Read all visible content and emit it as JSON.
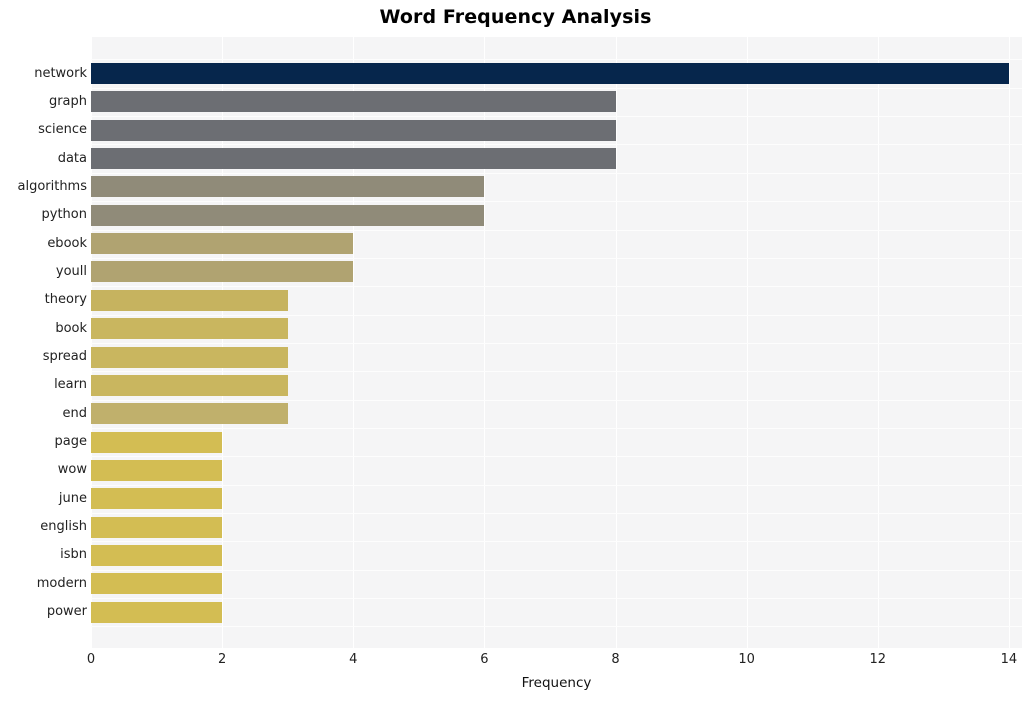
{
  "chart_data": {
    "type": "bar",
    "orientation": "horizontal",
    "title": "Word Frequency Analysis",
    "xlabel": "Frequency",
    "ylabel": "",
    "categories": [
      "network",
      "graph",
      "science",
      "data",
      "algorithms",
      "python",
      "ebook",
      "youll",
      "theory",
      "book",
      "spread",
      "learn",
      "end",
      "page",
      "wow",
      "june",
      "english",
      "isbn",
      "modern",
      "power"
    ],
    "values": [
      14,
      8,
      8,
      8,
      6,
      6,
      4,
      4,
      3,
      3,
      3,
      3,
      3,
      2,
      2,
      2,
      2,
      2,
      2,
      2
    ],
    "bar_colors": [
      "#06264c",
      "#6c6e73",
      "#6c6e73",
      "#6c6e73",
      "#908b79",
      "#908b79",
      "#b0a371",
      "#b0a371",
      "#c6b35f",
      "#c9b65f",
      "#c9b65f",
      "#c9b65f",
      "#c0b06c",
      "#d3bd53",
      "#d3bd53",
      "#d3bd53",
      "#d3bd53",
      "#d3bd53",
      "#d3bd53",
      "#d3bd53"
    ],
    "xlim": [
      0,
      14.2
    ],
    "xticks": [
      0,
      2,
      4,
      6,
      8,
      10,
      12,
      14
    ],
    "xticklabels": [
      "0",
      "2",
      "4",
      "6",
      "8",
      "10",
      "12",
      "14"
    ],
    "grid": true,
    "grid_color": "#ffffff",
    "plot_background": "#f5f5f6",
    "figure_background": "#ffffff",
    "legend": null
  }
}
